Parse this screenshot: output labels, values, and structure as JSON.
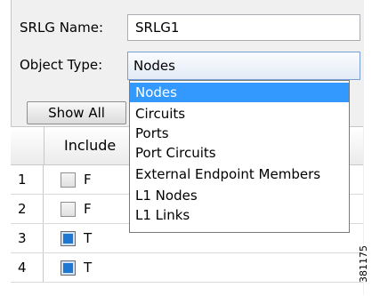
{
  "form": {
    "name_label": "SRLG Name:",
    "name_value": "SRLG1",
    "type_label": "Object Type:",
    "type_value": "Nodes",
    "show_all_label": "Show All"
  },
  "dropdown": {
    "options": [
      "Nodes",
      "Circuits",
      "Ports",
      "Port Circuits",
      "External Endpoint Members",
      "L1 Nodes",
      "L1 Links"
    ],
    "selected_index": 0
  },
  "table": {
    "header_include": "Include",
    "rows": [
      {
        "num": "1",
        "value": "F",
        "checked": false
      },
      {
        "num": "2",
        "value": "F",
        "checked": false
      },
      {
        "num": "3",
        "value": "T",
        "checked": true
      },
      {
        "num": "4",
        "value": "T",
        "checked": true
      }
    ]
  },
  "figure_id": "381175",
  "colors": {
    "selection": "#3399ff",
    "checkbox_on": "#1e78d2"
  }
}
